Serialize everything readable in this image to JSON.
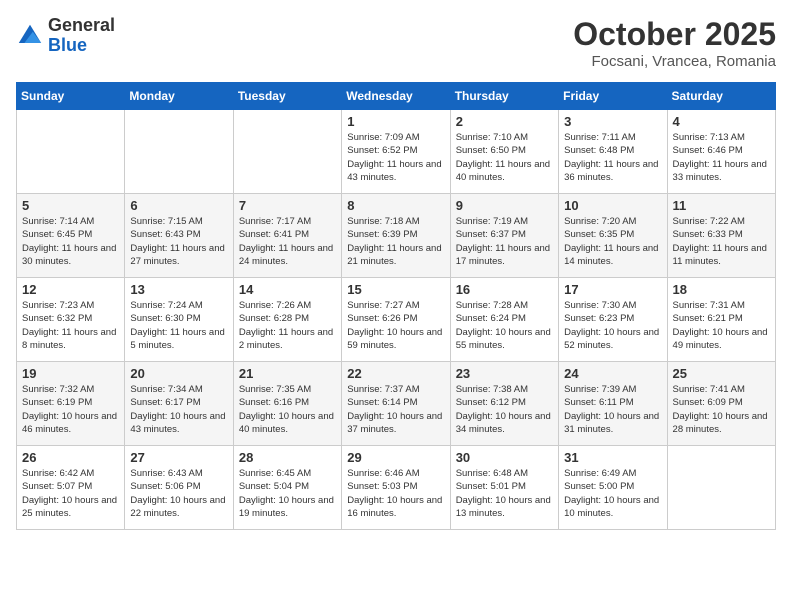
{
  "logo": {
    "general": "General",
    "blue": "Blue"
  },
  "title": "October 2025",
  "location": "Focsani, Vrancea, Romania",
  "weekdays": [
    "Sunday",
    "Monday",
    "Tuesday",
    "Wednesday",
    "Thursday",
    "Friday",
    "Saturday"
  ],
  "weeks": [
    [
      {
        "day": "",
        "info": ""
      },
      {
        "day": "",
        "info": ""
      },
      {
        "day": "",
        "info": ""
      },
      {
        "day": "1",
        "info": "Sunrise: 7:09 AM\nSunset: 6:52 PM\nDaylight: 11 hours and 43 minutes."
      },
      {
        "day": "2",
        "info": "Sunrise: 7:10 AM\nSunset: 6:50 PM\nDaylight: 11 hours and 40 minutes."
      },
      {
        "day": "3",
        "info": "Sunrise: 7:11 AM\nSunset: 6:48 PM\nDaylight: 11 hours and 36 minutes."
      },
      {
        "day": "4",
        "info": "Sunrise: 7:13 AM\nSunset: 6:46 PM\nDaylight: 11 hours and 33 minutes."
      }
    ],
    [
      {
        "day": "5",
        "info": "Sunrise: 7:14 AM\nSunset: 6:45 PM\nDaylight: 11 hours and 30 minutes."
      },
      {
        "day": "6",
        "info": "Sunrise: 7:15 AM\nSunset: 6:43 PM\nDaylight: 11 hours and 27 minutes."
      },
      {
        "day": "7",
        "info": "Sunrise: 7:17 AM\nSunset: 6:41 PM\nDaylight: 11 hours and 24 minutes."
      },
      {
        "day": "8",
        "info": "Sunrise: 7:18 AM\nSunset: 6:39 PM\nDaylight: 11 hours and 21 minutes."
      },
      {
        "day": "9",
        "info": "Sunrise: 7:19 AM\nSunset: 6:37 PM\nDaylight: 11 hours and 17 minutes."
      },
      {
        "day": "10",
        "info": "Sunrise: 7:20 AM\nSunset: 6:35 PM\nDaylight: 11 hours and 14 minutes."
      },
      {
        "day": "11",
        "info": "Sunrise: 7:22 AM\nSunset: 6:33 PM\nDaylight: 11 hours and 11 minutes."
      }
    ],
    [
      {
        "day": "12",
        "info": "Sunrise: 7:23 AM\nSunset: 6:32 PM\nDaylight: 11 hours and 8 minutes."
      },
      {
        "day": "13",
        "info": "Sunrise: 7:24 AM\nSunset: 6:30 PM\nDaylight: 11 hours and 5 minutes."
      },
      {
        "day": "14",
        "info": "Sunrise: 7:26 AM\nSunset: 6:28 PM\nDaylight: 11 hours and 2 minutes."
      },
      {
        "day": "15",
        "info": "Sunrise: 7:27 AM\nSunset: 6:26 PM\nDaylight: 10 hours and 59 minutes."
      },
      {
        "day": "16",
        "info": "Sunrise: 7:28 AM\nSunset: 6:24 PM\nDaylight: 10 hours and 55 minutes."
      },
      {
        "day": "17",
        "info": "Sunrise: 7:30 AM\nSunset: 6:23 PM\nDaylight: 10 hours and 52 minutes."
      },
      {
        "day": "18",
        "info": "Sunrise: 7:31 AM\nSunset: 6:21 PM\nDaylight: 10 hours and 49 minutes."
      }
    ],
    [
      {
        "day": "19",
        "info": "Sunrise: 7:32 AM\nSunset: 6:19 PM\nDaylight: 10 hours and 46 minutes."
      },
      {
        "day": "20",
        "info": "Sunrise: 7:34 AM\nSunset: 6:17 PM\nDaylight: 10 hours and 43 minutes."
      },
      {
        "day": "21",
        "info": "Sunrise: 7:35 AM\nSunset: 6:16 PM\nDaylight: 10 hours and 40 minutes."
      },
      {
        "day": "22",
        "info": "Sunrise: 7:37 AM\nSunset: 6:14 PM\nDaylight: 10 hours and 37 minutes."
      },
      {
        "day": "23",
        "info": "Sunrise: 7:38 AM\nSunset: 6:12 PM\nDaylight: 10 hours and 34 minutes."
      },
      {
        "day": "24",
        "info": "Sunrise: 7:39 AM\nSunset: 6:11 PM\nDaylight: 10 hours and 31 minutes."
      },
      {
        "day": "25",
        "info": "Sunrise: 7:41 AM\nSunset: 6:09 PM\nDaylight: 10 hours and 28 minutes."
      }
    ],
    [
      {
        "day": "26",
        "info": "Sunrise: 6:42 AM\nSunset: 5:07 PM\nDaylight: 10 hours and 25 minutes."
      },
      {
        "day": "27",
        "info": "Sunrise: 6:43 AM\nSunset: 5:06 PM\nDaylight: 10 hours and 22 minutes."
      },
      {
        "day": "28",
        "info": "Sunrise: 6:45 AM\nSunset: 5:04 PM\nDaylight: 10 hours and 19 minutes."
      },
      {
        "day": "29",
        "info": "Sunrise: 6:46 AM\nSunset: 5:03 PM\nDaylight: 10 hours and 16 minutes."
      },
      {
        "day": "30",
        "info": "Sunrise: 6:48 AM\nSunset: 5:01 PM\nDaylight: 10 hours and 13 minutes."
      },
      {
        "day": "31",
        "info": "Sunrise: 6:49 AM\nSunset: 5:00 PM\nDaylight: 10 hours and 10 minutes."
      },
      {
        "day": "",
        "info": ""
      }
    ]
  ]
}
